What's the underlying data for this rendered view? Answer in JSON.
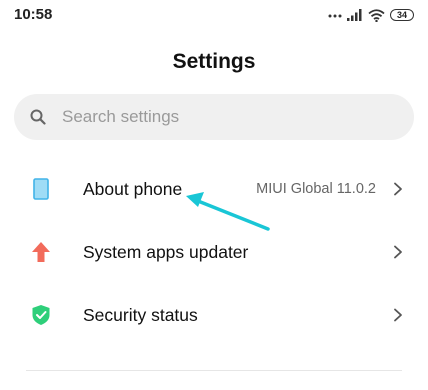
{
  "status_bar": {
    "time": "10:58",
    "battery": "34",
    "icons": [
      "signal-dots-icon",
      "cellular-signal-icon",
      "wifi-icon",
      "battery-icon"
    ]
  },
  "header": {
    "title": "Settings"
  },
  "search": {
    "placeholder": "Search settings",
    "value": "",
    "icon": "search-icon"
  },
  "settings": {
    "items": [
      {
        "label": "About phone",
        "value": "MIUI Global 11.0.2",
        "icon": "phone-icon",
        "icon_color": "#5bc0f0"
      },
      {
        "label": "System apps updater",
        "value": "",
        "icon": "up-arrow-icon",
        "icon_color": "#f26b5b"
      },
      {
        "label": "Security status",
        "value": "",
        "icon": "shield-check-icon",
        "icon_color": "#2ecf7a"
      }
    ]
  },
  "annotation": {
    "color": "#19c6d6",
    "icon": "pointer-arrow-icon"
  },
  "colors": {
    "background": "#ffffff",
    "search_bg": "#f0f0f0",
    "text": "#111111",
    "secondary": "#666666"
  }
}
